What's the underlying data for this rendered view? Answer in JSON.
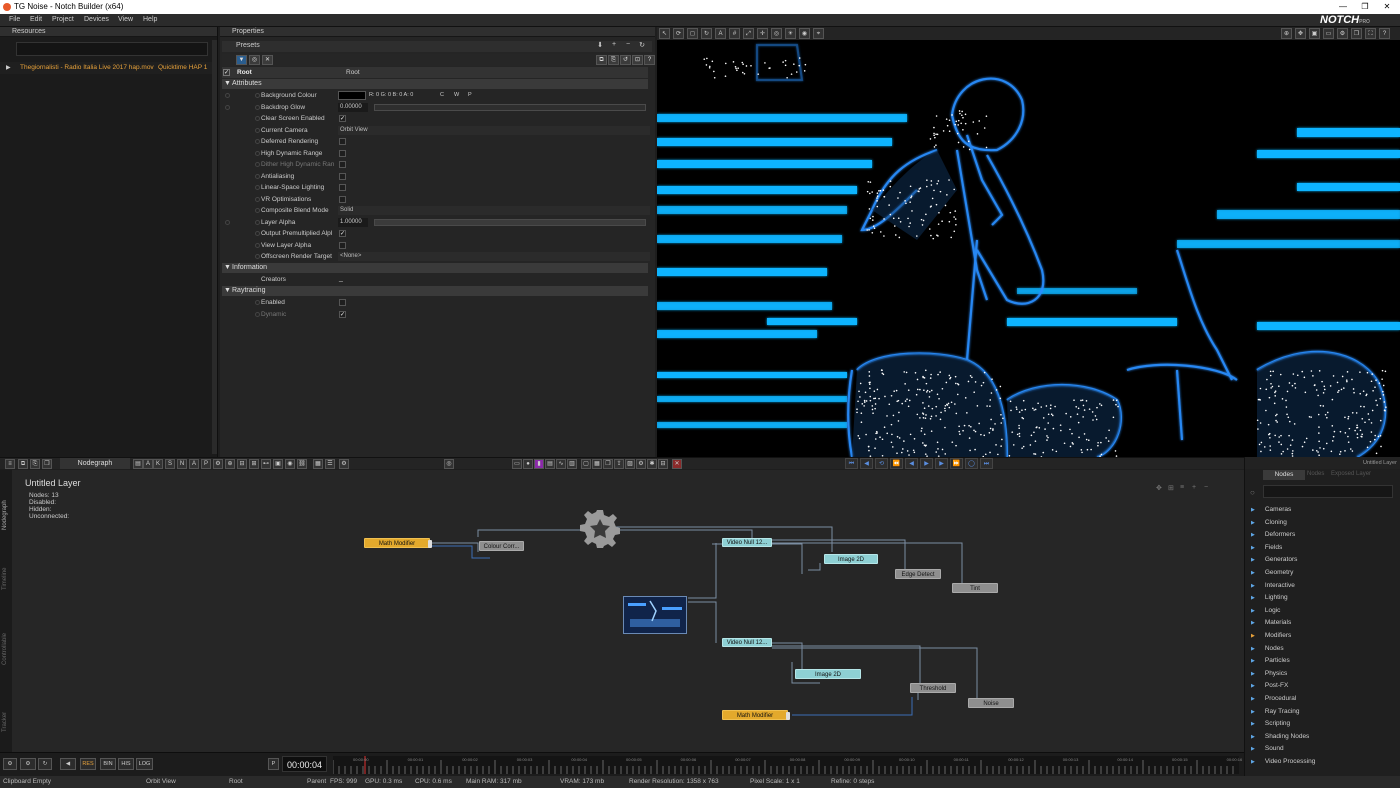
{
  "window": {
    "title": "TG Noise - Notch Builder (x64)"
  },
  "menu": [
    "File",
    "Edit",
    "Project",
    "Devices",
    "View",
    "Help"
  ],
  "brand": {
    "logo": "NOTCH",
    "edition": "PRO"
  },
  "resources": {
    "header": "Resources",
    "item": {
      "name": "Thegiornalisti - Radio Italia Live 2017 hap.mov",
      "codec": "Quicktime HAP 1"
    }
  },
  "properties": {
    "header": "Properties",
    "presets_label": "Presets",
    "root_label": "Root",
    "root_value": "Root",
    "sections": {
      "attributes": "Attributes",
      "information": "Information",
      "raytracing": "Raytracing"
    },
    "background_colour": {
      "label": "Background Colour",
      "value": "R: 0 G: 0 B: 0 A: 0",
      "c": "C",
      "w": "W",
      "p": "P"
    },
    "backdrop_glow": {
      "label": "Backdrop Glow",
      "value": "0.00000"
    },
    "clear_screen": {
      "label": "Clear Screen Enabled"
    },
    "current_camera": {
      "label": "Current Camera",
      "value": "Orbit View"
    },
    "deferred_rendering": {
      "label": "Deferred Rendering"
    },
    "hdr": {
      "label": "High Dynamic Range"
    },
    "dither_hdr": {
      "label": "Dither High Dynamic Ran"
    },
    "antialiasing": {
      "label": "Antialiasing"
    },
    "linear_lighting": {
      "label": "Linear-Space Lighting"
    },
    "vr_opt": {
      "label": "VR Optimisations"
    },
    "blend_mode": {
      "label": "Composite Blend Mode",
      "value": "Solid"
    },
    "layer_alpha": {
      "label": "Layer Alpha",
      "value": "1.00000"
    },
    "output_premult": {
      "label": "Output Premultiplied Alpl"
    },
    "view_layer_alpha": {
      "label": "View Layer Alpha"
    },
    "offscreen_target": {
      "label": "Offscreen Render Target",
      "value": "<None>"
    },
    "creators": {
      "label": "Creators",
      "value": "_"
    },
    "enabled": {
      "label": "Enabled"
    },
    "dynamic": {
      "label": "Dynamic"
    },
    "checkmark": "✓"
  },
  "nodegraph": {
    "tab": "Nodegraph",
    "toolbar_letters": [
      "A",
      "K",
      "S",
      "N",
      "A",
      "P"
    ],
    "layer_title": "Untitled  Layer",
    "stats": {
      "nodes": "Nodes:  13",
      "disabled": "Disabled:",
      "hidden": "Hidden:",
      "unconnected": "Unconnected:"
    },
    "side_tabs": [
      "Nodegraph",
      "Timeline",
      "Controllable",
      "Tracker"
    ],
    "nodes": {
      "math1": "Math  Modifier",
      "colour": "Colour  Corr...",
      "vnull1": "Video  Null  12...",
      "image1": "Image  2D",
      "edge": "Edge  Detect",
      "tint": "Tint",
      "vnull2": "Video  Null  12...",
      "image2": "Image  2D",
      "threshold": "Threshold",
      "noise": "Noise",
      "math2": "Math  Modifier"
    }
  },
  "nodes_panel": {
    "tab": "Nodes",
    "tab2": "Nodes",
    "tab3": "Exposed  Layer",
    "corner": "Untitled  Layer",
    "categories": [
      "Cameras",
      "Cloning",
      "Deformers",
      "Fields",
      "Generators",
      "Geometry",
      "Interactive",
      "Lighting",
      "Logic",
      "Materials",
      "Modifiers",
      "Nodes",
      "Particles",
      "Physics",
      "Post-FX",
      "Procedural",
      "Ray Tracing",
      "Scripting",
      "Shading Nodes",
      "Sound",
      "Video Processing"
    ]
  },
  "timeline": {
    "buttons": [
      "RES",
      "BIN",
      "HIS",
      "LOG"
    ],
    "timecode": "00:00:04",
    "ruler": [
      "00:00:00",
      "00:00:01",
      "00:00:02",
      "00:00:03",
      "00:00:04",
      "00:00:05",
      "00:00:06",
      "00:00:07",
      "00:00:08",
      "00:00:09",
      "00:00:10",
      "00:00:11",
      "00:00:12",
      "00:00:13",
      "00:00:14",
      "00:00:15",
      "00:00:16"
    ]
  },
  "status": {
    "clipboard": "Clipboard Empty",
    "camera": "Orbit View",
    "root": "Root",
    "parent": "Parent",
    "fps": "FPS: 999",
    "gpu": "GPU: 0.3 ms",
    "cpu": "CPU: 0.6 ms",
    "ram": "Main RAM: 317 mb",
    "vram": "VRAM: 173 mb",
    "resolution": "Render Resolution: 1358 x 763",
    "pixel_scale": "Pixel Scale: 1 x 1",
    "refine": "Refine: 0 steps"
  },
  "colors": {
    "accent_orange": "#e8a23a",
    "node_yellow": "#e3a92c",
    "node_cyan": "#8ed0d4",
    "viewport_line": "#0fb4ff"
  }
}
